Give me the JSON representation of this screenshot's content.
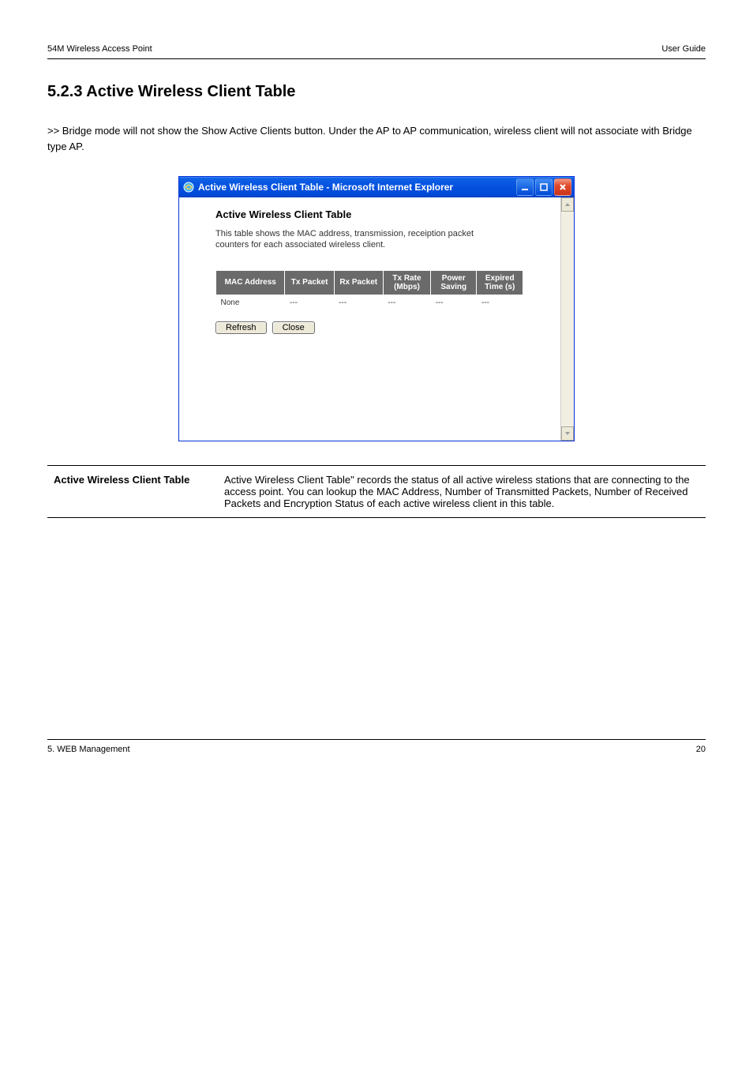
{
  "header": {
    "left": "54M Wireless Access Point",
    "right": "User Guide"
  },
  "section_title": "5.2.3 Active Wireless Client Table",
  "bridge_note": ">> Bridge mode will not show the Show Active Clients button. Under the AP to AP communication, wireless client will not associate with Bridge type AP.",
  "window": {
    "title": "Active Wireless Client Table - Microsoft Internet Explorer",
    "heading": "Active Wireless Client Table",
    "description": "This table shows the MAC address, transmission, receiption packet counters for each associated wireless client.",
    "columns": [
      "MAC Address",
      "Tx Packet",
      "Rx Packet",
      "Tx Rate (Mbps)",
      "Power Saving",
      "Expired Time (s)"
    ],
    "row0": [
      "None",
      "---",
      "---",
      "---",
      "---",
      "---"
    ],
    "buttons": {
      "refresh": "Refresh",
      "close": "Close"
    }
  },
  "def": {
    "label": "Active Wireless Client Table",
    "text": "Active Wireless Client Table\" records the status of all active wireless stations that are connecting to the access point. You can lookup the MAC Address, Number of Transmitted Packets, Number of Received Packets and Encryption Status of each active wireless client in this table."
  },
  "footer": {
    "left": "5. WEB Management",
    "right": "20"
  },
  "chart_data": {
    "type": "table",
    "title": "Active Wireless Client Table",
    "columns": [
      "MAC Address",
      "Tx Packet",
      "Rx Packet",
      "Tx Rate (Mbps)",
      "Power Saving",
      "Expired Time (s)"
    ],
    "rows": [
      [
        "None",
        "---",
        "---",
        "---",
        "---",
        "---"
      ]
    ]
  }
}
